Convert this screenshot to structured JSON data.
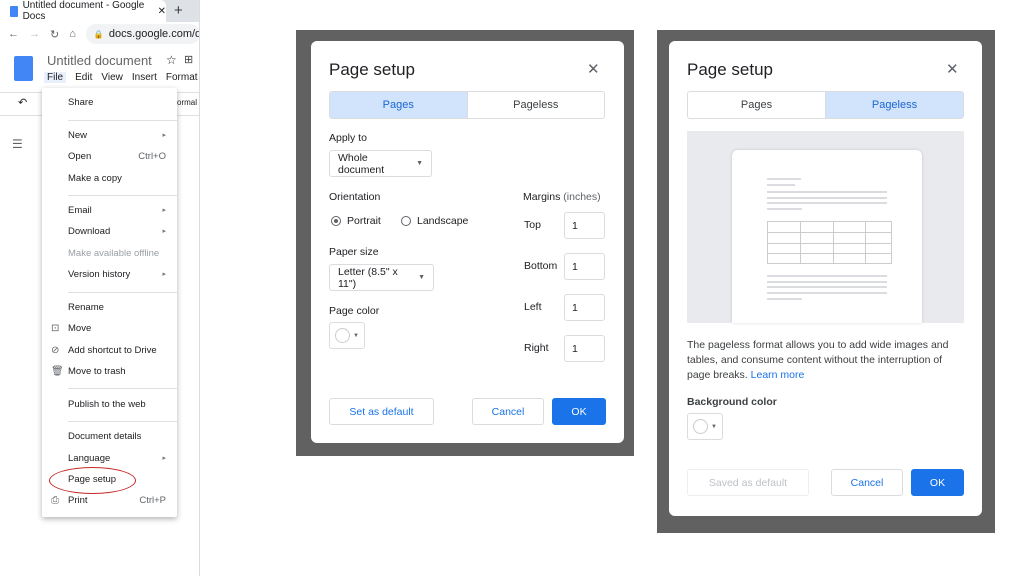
{
  "browser": {
    "tab_title": "Untitled document - Google Docs",
    "url": "docs.google.com/do"
  },
  "docs": {
    "doc_title": "Untitled document",
    "menubar": [
      "File",
      "Edit",
      "View",
      "Insert",
      "Format"
    ],
    "toolbar_style": "ormal"
  },
  "file_menu": {
    "items": [
      {
        "label": "Share"
      },
      {
        "label": "New",
        "submenu": true
      },
      {
        "label": "Open",
        "shortcut": "Ctrl+O"
      },
      {
        "label": "Make a copy"
      },
      {
        "label": "Email",
        "submenu": true
      },
      {
        "label": "Download",
        "submenu": true
      },
      {
        "label": "Make available offline",
        "disabled": true
      },
      {
        "label": "Version history",
        "submenu": true
      },
      {
        "label": "Rename"
      },
      {
        "label": "Move",
        "icon": "folder-move-icon"
      },
      {
        "label": "Add shortcut to Drive",
        "icon": "drive-shortcut-icon"
      },
      {
        "label": "Move to trash",
        "icon": "trash-icon"
      },
      {
        "label": "Publish to the web"
      },
      {
        "label": "Document details"
      },
      {
        "label": "Language",
        "submenu": true
      },
      {
        "label": "Page setup",
        "highlighted_circle": true
      },
      {
        "label": "Print",
        "shortcut": "Ctrl+P",
        "icon": "print-icon"
      }
    ],
    "circle_color": "#c62828"
  },
  "dialog_pages": {
    "title": "Page setup",
    "tabs": [
      "Pages",
      "Pageless"
    ],
    "active_tab": "Pages",
    "apply_to_label": "Apply to",
    "apply_to_value": "Whole document",
    "orientation_label": "Orientation",
    "orientation_options": [
      "Portrait",
      "Landscape"
    ],
    "orientation_selected": "Portrait",
    "paper_size_label": "Paper size",
    "paper_size_value": "Letter (8.5\" x 11\")",
    "page_color_label": "Page color",
    "margins_label": "Margins",
    "margins_unit": "(inches)",
    "margins": [
      {
        "label": "Top",
        "value": "1"
      },
      {
        "label": "Bottom",
        "value": "1"
      },
      {
        "label": "Left",
        "value": "1"
      },
      {
        "label": "Right",
        "value": "1"
      }
    ],
    "set_default": "Set as default",
    "cancel": "Cancel",
    "ok": "OK"
  },
  "dialog_pageless": {
    "title": "Page setup",
    "tabs": [
      "Pages",
      "Pageless"
    ],
    "active_tab": "Pageless",
    "description": "The pageless format allows you to add wide images and tables, and consume content without the interruption of page breaks.",
    "learn_more": "Learn more",
    "bg_color_label": "Background color",
    "saved_default": "Saved as default",
    "cancel": "Cancel",
    "ok": "OK"
  },
  "colors": {
    "accent": "#1a73e8",
    "tab_active": "#d2e3fc",
    "frame": "#616161"
  }
}
